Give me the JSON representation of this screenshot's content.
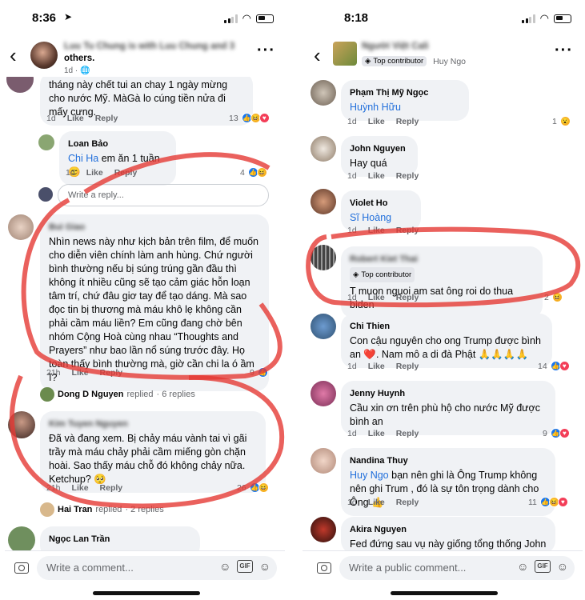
{
  "left": {
    "status_time": "8:36",
    "header_title": "Luu Tu Chung is with Luu Chung and 3",
    "header_title2": "others.",
    "header_sub": "1d",
    "comments": [
      {
        "text": "tháng này chết tui an chay 1 ngày mừng cho nước Mỹ. MàGà lo cúng tiền nửa đi mấy cưng.",
        "time": "1d",
        "like": "Like",
        "reply": "Reply",
        "count": "13"
      },
      {
        "name": "Loan Bảo",
        "tag": "Chi Ha",
        "text": " em ăn 1 tuần 😊",
        "time": "1d",
        "like": "Like",
        "reply": "Reply",
        "count": "4"
      },
      {
        "name": "Bui Giao",
        "text": "Nhìn news này như kịch bản trên film, để muốn cho diễn viên chính làm anh hùng.  Chứ người bình thường nếu bị súng trúng gần đầu thì không ít nhiều cũng sẽ tạo cảm giác hỗn loạn tâm trí, chứ đâu giơ tay để tạo dáng. Mà sao đọc tin bị thương mà máu khô lẹ không cần phải cầm máu liền?  Em cũng đang chờ bên nhóm Cộng Hoà cùng nhau “Thoughts and Prayers” như bao lần nổ súng trước đây.  Họ toàn thấy bình thường mà, giờ cần chi la ó ầm ĩ?",
        "time": "21h",
        "like": "Like",
        "reply": "Reply",
        "count": "9"
      },
      {
        "name": "Kim Tuyen Nguyen",
        "text": "Đã và đang xem. Bị chảy máu vành tai vì gãi trầy mà máu chảy phải cầm miếng gòn chặn hoài. Sao thấy máu chỗ đó không chảy nữa. Ketchup? 🥺",
        "time": "21h",
        "like": "Like",
        "reply": "Reply",
        "count": "26"
      },
      {
        "name": "Ngọc Lan Trần"
      }
    ],
    "write_reply": "Write a reply...",
    "reply_line1": {
      "name": "Dong D Nguyen",
      "action": "replied",
      "count": "· 6 replies"
    },
    "reply_line2": {
      "name": "Hai Tran",
      "action": "replied",
      "count": "· 2 replies"
    },
    "composer_placeholder": "Write a comment..."
  },
  "right": {
    "status_time": "8:18",
    "header_title": "Người Việt Cali",
    "header_badge": "Top contributor",
    "header_user": "Huy Ngo",
    "comments": [
      {
        "name": "Phạm Thị Mỹ Ngọc",
        "tag": "Huỳnh Hữu",
        "time": "1d",
        "like": "Like",
        "reply": "Reply",
        "count": "1"
      },
      {
        "name": "John Nguyen",
        "text": "Hay quá",
        "time": "1d",
        "like": "Like",
        "reply": "Reply"
      },
      {
        "name": "Violet Ho",
        "tag": "Sĩ Hoàng",
        "time": "1d",
        "like": "Like",
        "reply": "Reply"
      },
      {
        "name": "Robert Kiet Thai",
        "badge": "Top contributor",
        "text": "T muon nguoi am sat ông roi do thua biden",
        "time": "1d",
        "like": "Like",
        "reply": "Reply",
        "count": "2"
      },
      {
        "name": "Chi Thien",
        "text": "Con cậu nguyên cho ong Trump được bình an ❤️. Nam mô a di đà Phật 🙏🙏🙏🙏",
        "time": "1d",
        "like": "Like",
        "reply": "Reply",
        "count": "14"
      },
      {
        "name": "Jenny Huynh",
        "text": "Cầu xin ơn trên phù hộ cho nước Mỹ được bình an",
        "time": "1d",
        "like": "Like",
        "reply": "Reply",
        "count": "9"
      },
      {
        "name": "Nandina Thuy",
        "tag": "Huy Ngo",
        "text": " bạn nên ghi là Ông Trump không nên ghi Trum , đó là sự tôn trọng dành cho Ông 👍",
        "time": "1d",
        "like": "Like",
        "reply": "Reply",
        "count": "11"
      },
      {
        "name": "Akira Nguyen",
        "text": "Fed đứng sau vụ này giống tổng thống John F."
      }
    ],
    "composer_placeholder": "Write a public comment..."
  },
  "composer_gif": "GIF",
  "colors": {
    "accent": "#1877f2",
    "bubble": "#f0f2f5",
    "marker": "#e53935"
  }
}
